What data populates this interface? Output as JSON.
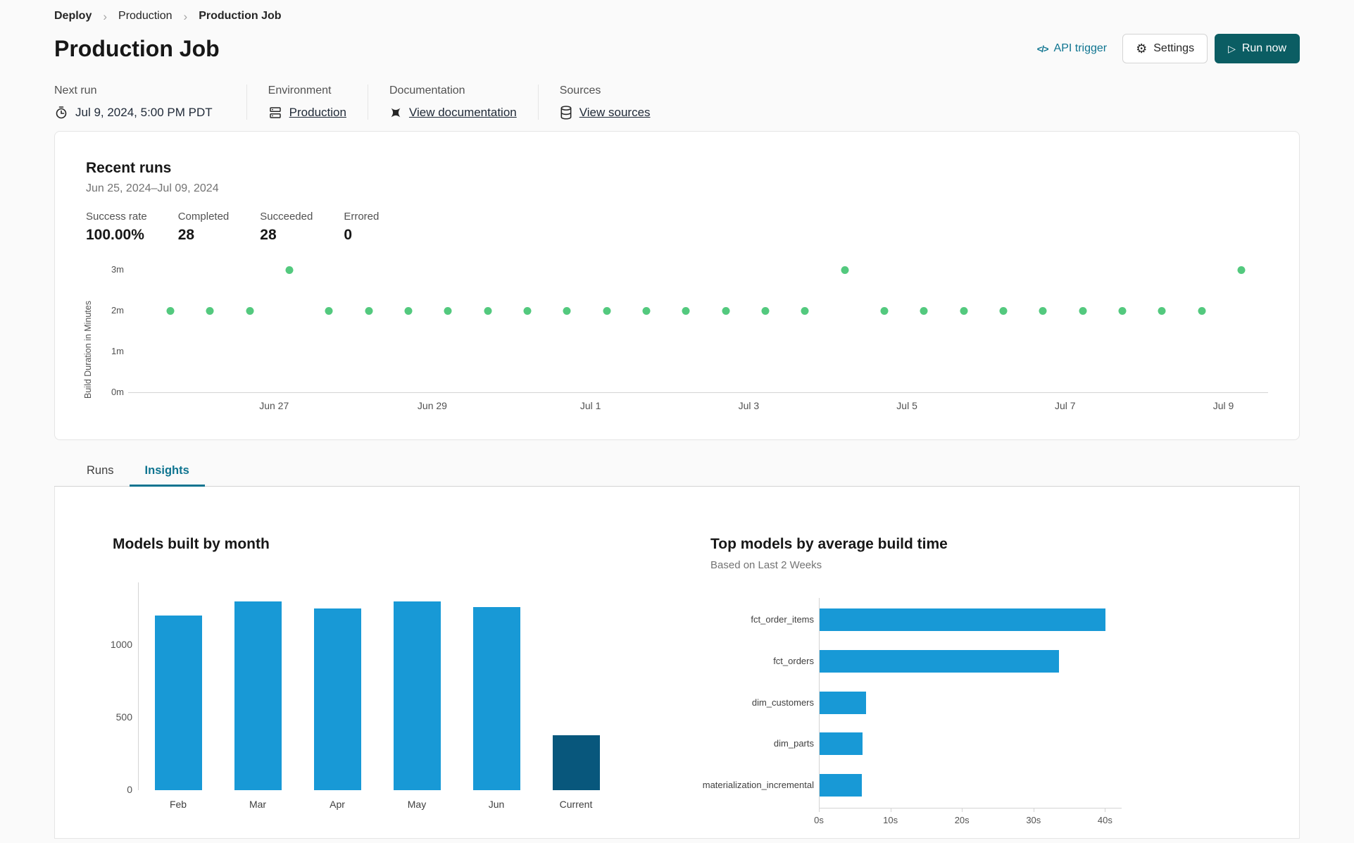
{
  "colors": {
    "accent_teal": "#0e7490",
    "run_now_bg": "#0b5d63",
    "bar_blue": "#1899d6",
    "bar_dark": "#08577c",
    "dot_green": "#53c97e"
  },
  "breadcrumb": {
    "items": [
      "Deploy",
      "Production",
      "Production Job"
    ]
  },
  "header": {
    "title": "Production Job",
    "api_trigger_icon": "</>",
    "api_trigger_label": "API trigger",
    "settings_label": "Settings",
    "run_now_label": "Run now"
  },
  "meta": {
    "sections": [
      {
        "label": "Next run",
        "value": "Jul 9, 2024, 5:00 PM PDT",
        "icon": "clock-icon",
        "link": false
      },
      {
        "label": "Environment",
        "value": "Production",
        "icon": "environment-icon",
        "link": true
      },
      {
        "label": "Documentation",
        "value": "View documentation",
        "icon": "docs-icon",
        "link": true
      },
      {
        "label": "Sources",
        "value": "View sources",
        "icon": "database-icon",
        "link": true
      }
    ]
  },
  "recent_runs": {
    "title": "Recent runs",
    "date_range": "Jun 25, 2024–Jul 09, 2024",
    "stats": [
      {
        "label": "Success rate",
        "value": "100.00%"
      },
      {
        "label": "Completed",
        "value": "28"
      },
      {
        "label": "Succeeded",
        "value": "28"
      },
      {
        "label": "Errored",
        "value": "0"
      }
    ]
  },
  "tabs": [
    {
      "label": "Runs",
      "active": false
    },
    {
      "label": "Insights",
      "active": true
    }
  ],
  "chart_data": [
    {
      "id": "build-duration-scatter",
      "type": "scatter",
      "ylabel": "Build Duration in Minutes",
      "yticks": [
        0,
        1,
        2,
        3
      ],
      "ytick_labels": [
        "0m",
        "1m",
        "2m",
        "3m"
      ],
      "xtick_labels": [
        "Jun 27",
        "Jun 29",
        "Jul 1",
        "Jul 3",
        "Jul 5",
        "Jul 7",
        "Jul 9"
      ],
      "ylim": [
        0,
        3.25
      ],
      "point_color": "#53c97e",
      "points_minutes": [
        2,
        2,
        2,
        3,
        2,
        2,
        2,
        2,
        2,
        2,
        2,
        2,
        2,
        2,
        2,
        2,
        2,
        3,
        2,
        2,
        2,
        2,
        2,
        2,
        2,
        2,
        2,
        3
      ]
    },
    {
      "id": "models-built-by-month",
      "type": "bar",
      "title": "Models built by month",
      "categories": [
        "Feb",
        "Mar",
        "Apr",
        "May",
        "Jun",
        "Current"
      ],
      "values": [
        1200,
        1300,
        1250,
        1300,
        1260,
        380
      ],
      "yticks": [
        0,
        500,
        1000
      ],
      "ylim": [
        0,
        1430
      ],
      "bar_color": "#1899d6",
      "highlight_category": "Current",
      "highlight_color": "#08577c"
    },
    {
      "id": "top-models-by-average-build-time",
      "type": "bar",
      "orientation": "horizontal",
      "title": "Top models by average build time",
      "subtitle": "Based on Last 2 Weeks",
      "categories": [
        "fct_order_items",
        "fct_orders",
        "dim_customers",
        "dim_parts",
        "materialization_incremental"
      ],
      "values_seconds": [
        40,
        33.5,
        6.5,
        6,
        5.9
      ],
      "xticks": [
        0,
        10,
        20,
        30,
        40
      ],
      "xtick_labels": [
        "0s",
        "10s",
        "20s",
        "30s",
        "40s"
      ],
      "xlim": [
        0,
        42
      ],
      "bar_color": "#1899d6"
    }
  ]
}
